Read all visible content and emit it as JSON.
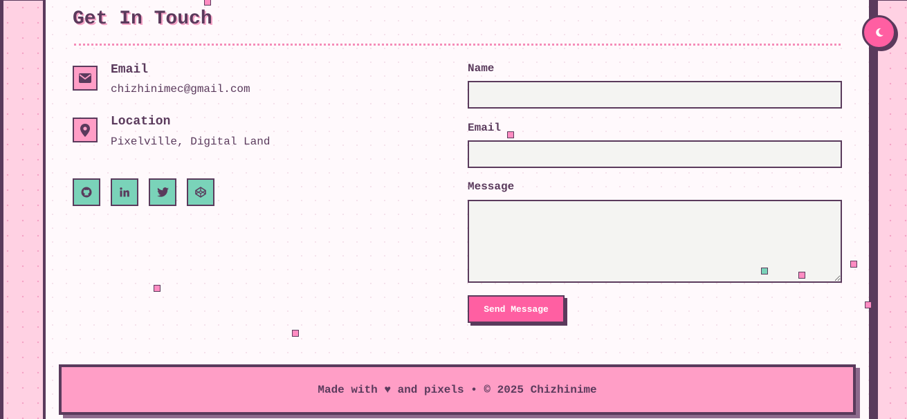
{
  "contact": {
    "title": "Get In Touch",
    "info": [
      {
        "label": "Email",
        "value": "chizhinimec@gmail.com",
        "icon": "envelope-icon"
      },
      {
        "label": "Location",
        "value": "Pixelville, Digital Land",
        "icon": "map-marker-icon"
      }
    ],
    "socials": [
      {
        "icon": "github-icon"
      },
      {
        "icon": "linkedin-icon"
      },
      {
        "icon": "twitter-icon"
      },
      {
        "icon": "codepen-icon"
      }
    ]
  },
  "form": {
    "name_label": "Name",
    "name_value": "",
    "email_label": "Email",
    "email_value": "",
    "message_label": "Message",
    "message_value": "",
    "submit_label": "Send Message"
  },
  "footer": {
    "text": "Made with ♥ and pixels • © 2025 Chizhinime"
  },
  "theme_toggle": {
    "icon": "moon-icon"
  },
  "colors": {
    "accent": "#ff5fa2",
    "accent_light": "#ff9ec6",
    "teal": "#7ad3b9",
    "ink": "#5a3a5c",
    "background": "#fff9fc",
    "side_pattern": "#ffd1e3"
  }
}
